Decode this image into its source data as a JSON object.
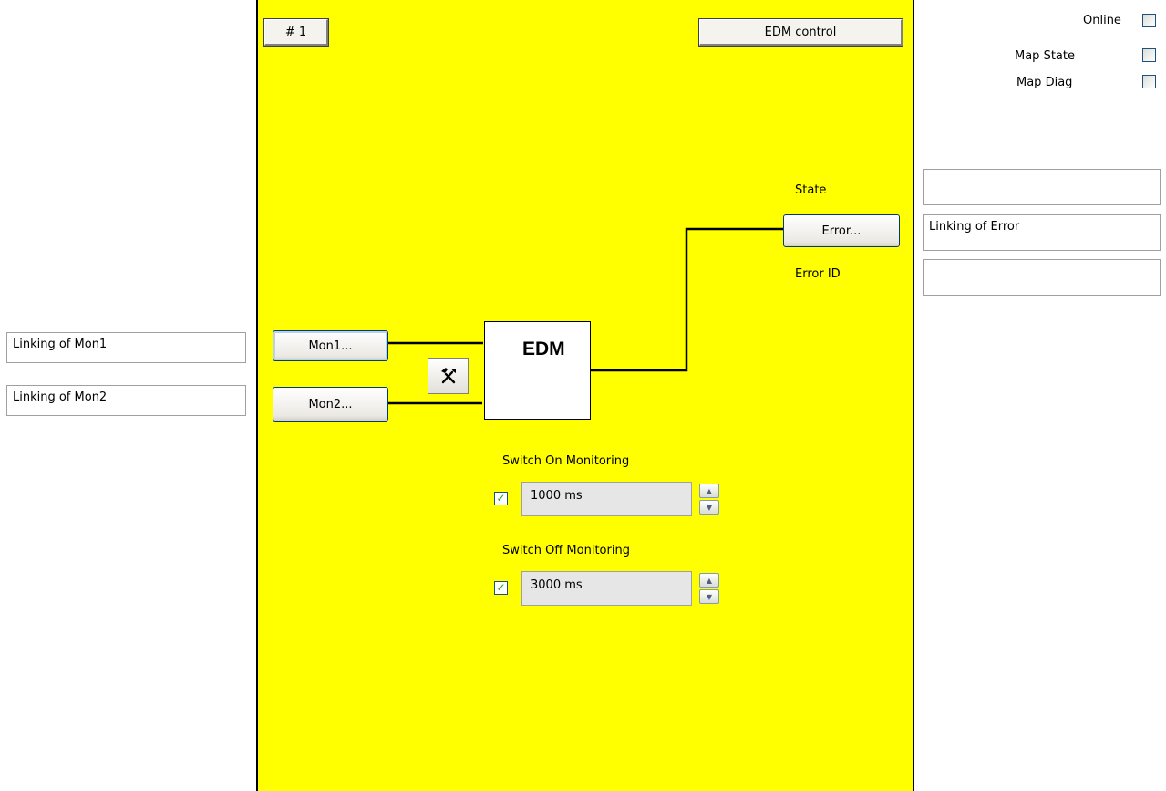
{
  "header": {
    "number_label": "# 1",
    "title_button": "EDM control"
  },
  "options": {
    "online": "Online",
    "map_state": "Map State",
    "map_diag": "Map Diag"
  },
  "inputs": {
    "mon1_button": "Mon1...",
    "mon2_button": "Mon2...",
    "mon1_link": "Linking of Mon1",
    "mon2_link": "Linking of Mon2"
  },
  "block": {
    "name": "EDM",
    "tool_icon": "tools-icon"
  },
  "outputs": {
    "state_label": "State",
    "error_button": "Error...",
    "error_id_label": "Error ID",
    "state_link": "",
    "error_link": "Linking of Error",
    "error_id_link": ""
  },
  "switch_on": {
    "label": "Switch On Monitoring",
    "value": "1000 ms",
    "enabled": true
  },
  "switch_off": {
    "label": "Switch Off Monitoring",
    "value": "3000 ms",
    "enabled": true
  },
  "colors": {
    "panel_background": "#ffff00",
    "button_border": "#003c74",
    "checkbox_tick": "#21a121"
  }
}
